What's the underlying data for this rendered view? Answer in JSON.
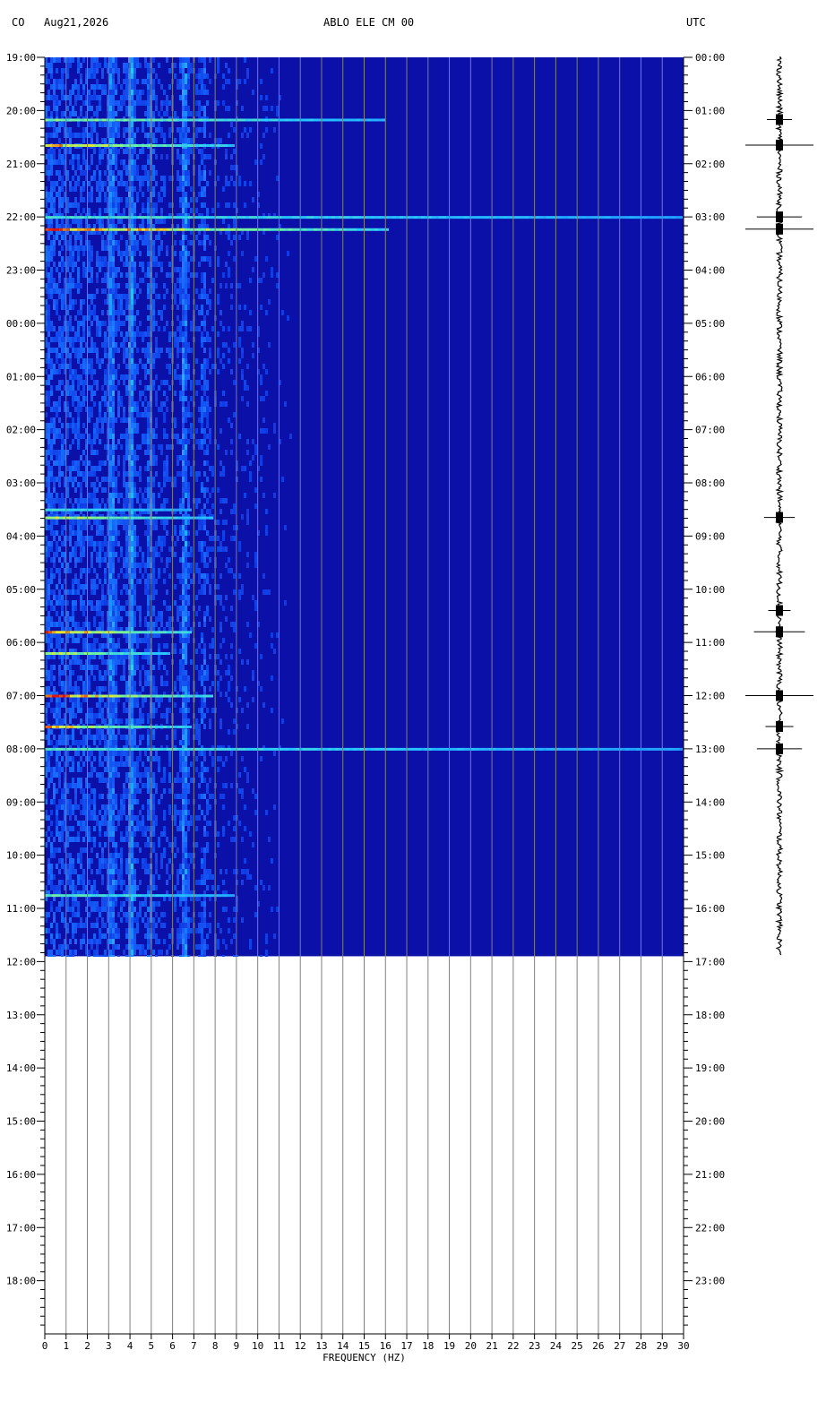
{
  "header": {
    "left_tz": "CO",
    "date": "Aug21,2026",
    "station": "ABLO ELE CM 00",
    "right_tz": "UTC"
  },
  "chart_data": {
    "type": "heatmap",
    "title": "ABLO ELE CM 00",
    "xlabel": "FREQUENCY (HZ)",
    "ylabel": "",
    "x_ticks": [
      0,
      1,
      2,
      3,
      4,
      5,
      6,
      7,
      8,
      9,
      10,
      11,
      12,
      13,
      14,
      15,
      16,
      17,
      18,
      19,
      20,
      21,
      22,
      23,
      24,
      25,
      26,
      27,
      28,
      29,
      30
    ],
    "xlim": [
      0,
      30
    ],
    "left_time_labels": [
      "19:00",
      "20:00",
      "21:00",
      "22:00",
      "23:00",
      "00:00",
      "01:00",
      "02:00",
      "03:00",
      "04:00",
      "05:00",
      "06:00",
      "07:00",
      "08:00",
      "09:00",
      "10:00",
      "11:00",
      "12:00",
      "13:00",
      "14:00",
      "15:00",
      "16:00",
      "17:00",
      "18:00"
    ],
    "right_time_labels": [
      "00:00",
      "01:00",
      "02:00",
      "03:00",
      "04:00",
      "05:00",
      "06:00",
      "07:00",
      "08:00",
      "09:00",
      "10:00",
      "11:00",
      "12:00",
      "13:00",
      "14:00",
      "15:00",
      "16:00",
      "17:00",
      "18:00",
      "19:00",
      "20:00",
      "21:00",
      "22:00",
      "23:00"
    ],
    "hours_total": 24,
    "data_hours": 16.9,
    "grid": true,
    "colors": {
      "background": "#0a10a8",
      "low": "#0a14c8",
      "mid": "#2a9cff",
      "high": "#7cf0a0",
      "peak": "#e01010",
      "grid": "#808080"
    },
    "frequency_bands": [
      {
        "freq": 3.1,
        "strength": 0.55
      },
      {
        "freq": 4.0,
        "strength": 0.7
      },
      {
        "freq": 4.9,
        "strength": 0.4
      },
      {
        "freq": 6.5,
        "strength": 0.75
      },
      {
        "freq": 7.4,
        "strength": 0.4
      }
    ],
    "events": [
      {
        "hour": 1.17,
        "extent_hz": 16.0,
        "intensity": 0.7
      },
      {
        "hour": 1.65,
        "extent_hz": 9.0,
        "intensity": 0.9
      },
      {
        "hour": 3.0,
        "extent_hz": 30.0,
        "intensity": 0.55
      },
      {
        "hour": 3.23,
        "extent_hz": 16.2,
        "intensity": 1.0
      },
      {
        "hour": 8.5,
        "extent_hz": 7.0,
        "intensity": 0.5
      },
      {
        "hour": 8.65,
        "extent_hz": 8.0,
        "intensity": 0.8
      },
      {
        "hour": 10.8,
        "extent_hz": 7.0,
        "intensity": 1.0
      },
      {
        "hour": 11.2,
        "extent_hz": 6.0,
        "intensity": 0.8
      },
      {
        "hour": 12.0,
        "extent_hz": 8.0,
        "intensity": 1.0
      },
      {
        "hour": 12.58,
        "extent_hz": 7.0,
        "intensity": 0.9
      },
      {
        "hour": 13.0,
        "extent_hz": 30.0,
        "intensity": 0.55
      },
      {
        "hour": 15.75,
        "extent_hz": 9.0,
        "intensity": 0.6
      }
    ],
    "seismogram_events": [
      {
        "hour": 1.17,
        "amplitude": 0.25
      },
      {
        "hour": 1.65,
        "amplitude": 1.0
      },
      {
        "hour": 3.0,
        "amplitude": 0.6
      },
      {
        "hour": 3.23,
        "amplitude": 1.0
      },
      {
        "hour": 8.65,
        "amplitude": 0.35
      },
      {
        "hour": 10.4,
        "amplitude": 0.2
      },
      {
        "hour": 10.8,
        "amplitude": 0.7
      },
      {
        "hour": 12.0,
        "amplitude": 1.0
      },
      {
        "hour": 12.58,
        "amplitude": 0.3
      },
      {
        "hour": 13.0,
        "amplitude": 0.6
      }
    ]
  }
}
